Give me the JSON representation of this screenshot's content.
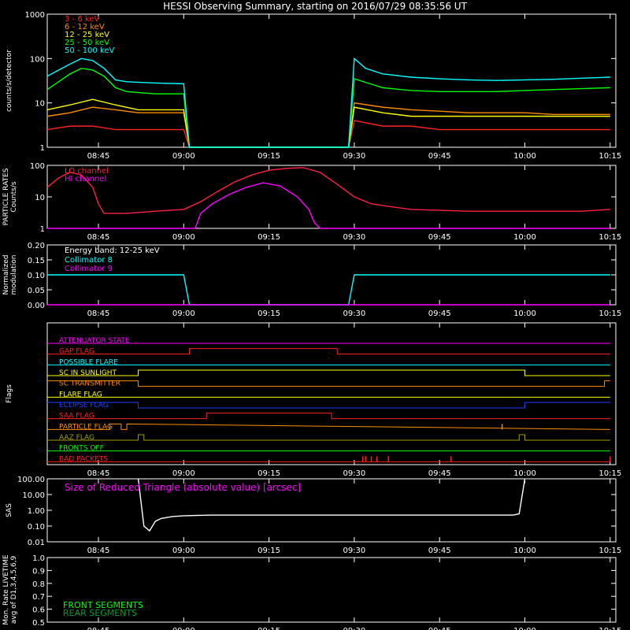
{
  "title": "HESSI Observing Summary, starting on 2016/07/29 08:35:56 UT",
  "time_labels": [
    "08:45",
    "09:00",
    "09:15",
    "09:30",
    "09:45",
    "10:00",
    "10:15"
  ],
  "time_values_min": [
    45,
    60,
    75,
    90,
    105,
    120,
    135
  ],
  "time_range_min": [
    36,
    136
  ],
  "colors": {
    "bg": "#000000",
    "axis": "#ffffff",
    "red": "#ff2020",
    "orange": "#ff8c00",
    "yellow": "#ffff00",
    "green": "#00ff00",
    "cyan": "#00ffff",
    "magenta": "#ff00ff",
    "blue": "#2040ff",
    "olive": "#a0a000",
    "crimson": "#ff2040",
    "darkgreen": "#00a020",
    "salmon": "#ff6060"
  },
  "chart_data": [
    {
      "type": "line",
      "panel": "count-rates",
      "ylabel": "counts/s/detector",
      "ylim": [
        1,
        1000
      ],
      "yscale": "log",
      "yticks": [
        "1",
        "10",
        "100",
        "1000"
      ],
      "ytick_values": [
        1,
        10,
        100,
        1000
      ],
      "data_gaps_min": [
        [
          61,
          89
        ]
      ],
      "series": [
        {
          "name": "3 - 6 keV",
          "color": "#ff2020",
          "x": [
            36,
            40,
            44,
            48,
            52,
            56,
            60,
            61,
            89,
            90,
            95,
            100,
            105,
            110,
            115,
            120,
            125,
            130,
            135
          ],
          "y": [
            2.5,
            3,
            3,
            2.5,
            2.5,
            2.5,
            2.5,
            1,
            1,
            4,
            3,
            3,
            2.5,
            2.5,
            2.5,
            2.5,
            2.5,
            2.5,
            2.5
          ]
        },
        {
          "name": "6 - 12 keV",
          "color": "#ff8c00",
          "x": [
            36,
            40,
            44,
            48,
            52,
            56,
            60,
            61,
            89,
            90,
            95,
            100,
            105,
            110,
            115,
            120,
            125,
            130,
            135
          ],
          "y": [
            5,
            6,
            8,
            7,
            6,
            6,
            6,
            1,
            1,
            10,
            8,
            7,
            6.5,
            6,
            6,
            6,
            5.5,
            5.5,
            5.5
          ]
        },
        {
          "name": "12 - 25 keV",
          "color": "#ffff00",
          "x": [
            36,
            40,
            44,
            48,
            52,
            56,
            60,
            61,
            89,
            90,
            95,
            100,
            105,
            110,
            115,
            120,
            125,
            130,
            135
          ],
          "y": [
            7,
            9,
            12,
            9,
            7,
            7,
            7,
            1,
            1,
            8,
            6,
            5,
            5,
            5,
            5,
            5,
            5,
            5,
            5
          ]
        },
        {
          "name": "25 - 50 keV",
          "color": "#00ff00",
          "x": [
            36,
            38,
            40,
            42,
            44,
            46,
            48,
            50,
            55,
            60,
            61,
            89,
            90,
            95,
            100,
            105,
            110,
            115,
            120,
            125,
            130,
            135
          ],
          "y": [
            20,
            30,
            45,
            60,
            55,
            40,
            22,
            18,
            16,
            16,
            1,
            1,
            35,
            22,
            19,
            18,
            18,
            18,
            19,
            20,
            21,
            22
          ]
        },
        {
          "name": "50 - 100 keV",
          "color": "#00ffff",
          "x": [
            36,
            38,
            40,
            42,
            44,
            46,
            48,
            50,
            55,
            60,
            61,
            89,
            90,
            92,
            95,
            100,
            105,
            110,
            115,
            120,
            125,
            130,
            135
          ],
          "y": [
            40,
            55,
            75,
            100,
            90,
            60,
            33,
            30,
            28,
            27,
            1,
            1,
            100,
            60,
            45,
            38,
            35,
            33,
            32,
            33,
            34,
            36,
            38
          ]
        }
      ]
    },
    {
      "type": "line",
      "panel": "particle-rates",
      "ylabel": "PARTICLE RATES Counts/s",
      "ylim": [
        1,
        100
      ],
      "yscale": "log",
      "yticks": [
        "1",
        "10",
        "100"
      ],
      "ytick_values": [
        1,
        10,
        100
      ],
      "series": [
        {
          "name": "LO channel",
          "color": "#ff2040",
          "x": [
            36,
            38,
            40,
            42,
            44,
            45,
            46,
            47,
            50,
            55,
            60,
            63,
            66,
            69,
            72,
            75,
            78,
            81,
            84,
            87,
            90,
            93,
            96,
            100,
            110,
            120,
            130,
            135
          ],
          "y": [
            20,
            40,
            60,
            50,
            20,
            6,
            3,
            3,
            3,
            3.5,
            4,
            7,
            15,
            30,
            50,
            70,
            80,
            85,
            60,
            25,
            10,
            6,
            5,
            4,
            3.5,
            3.5,
            3.5,
            4
          ]
        },
        {
          "name": "HI channel",
          "color": "#ff00ff",
          "x": [
            36,
            60,
            62,
            63,
            65,
            68,
            71,
            74,
            77,
            80,
            82,
            83,
            84,
            135
          ],
          "y": [
            1,
            1,
            1,
            3,
            6,
            12,
            20,
            28,
            22,
            10,
            4,
            1.5,
            1,
            1
          ]
        }
      ]
    },
    {
      "type": "line",
      "panel": "modulation",
      "ylabel": "Normalized modulation",
      "ylim": [
        0,
        0.2
      ],
      "yticks": [
        "0.00",
        "0.05",
        "0.10",
        "0.15",
        "0.20"
      ],
      "ytick_values": [
        0,
        0.05,
        0.1,
        0.15,
        0.2
      ],
      "annotation": "Energy band: 12-25 keV",
      "series": [
        {
          "name": "Collimator 8",
          "color": "#00ffff",
          "x": [
            36,
            60,
            61,
            89,
            90,
            135
          ],
          "y": [
            0.1,
            0.1,
            0,
            0,
            0.1,
            0.1
          ]
        },
        {
          "name": "Collimator 9",
          "color": "#ff00ff",
          "x": [
            36,
            135
          ],
          "y": [
            0,
            0
          ]
        }
      ]
    },
    {
      "type": "line",
      "panel": "flags",
      "ylabel": "Flags",
      "series": [
        {
          "name": "ATTENUATOR STATE",
          "color": "#ff00ff",
          "x": [
            36,
            135
          ],
          "y": [
            0,
            0
          ]
        },
        {
          "name": "GAP FLAG",
          "color": "#ff2020",
          "x": [
            36,
            61,
            61,
            87,
            87,
            135
          ],
          "y": [
            0,
            0,
            1,
            1,
            0,
            0
          ]
        },
        {
          "name": "POSSIBLE FLARE",
          "color": "#00ffff",
          "x": [
            36,
            135
          ],
          "y": [
            0,
            0
          ]
        },
        {
          "name": "SC IN SUNLIGHT",
          "color": "#ffff00",
          "x": [
            36,
            52,
            52,
            120,
            120,
            135
          ],
          "y": [
            0,
            0,
            1,
            1,
            0,
            0
          ]
        },
        {
          "name": "SC TRANSMITTER",
          "color": "#ff8c00",
          "x": [
            36,
            52,
            52,
            134,
            134,
            135
          ],
          "y": [
            1,
            1,
            0,
            0,
            1,
            1
          ]
        },
        {
          "name": "FLARE FLAG",
          "color": "#ffff00",
          "x": [
            36,
            135
          ],
          "y": [
            0,
            0
          ]
        },
        {
          "name": "ECLIPSE FLAG",
          "color": "#2040ff",
          "x": [
            36,
            52,
            52,
            120,
            120,
            135
          ],
          "y": [
            1,
            1,
            0,
            0,
            1,
            1
          ]
        },
        {
          "name": "SAA FLAG",
          "color": "#ff2020",
          "x": [
            36,
            64,
            64,
            86,
            86,
            135
          ],
          "y": [
            0,
            0,
            1,
            1,
            0,
            0
          ]
        },
        {
          "name": "PARTICLE FLAG",
          "color": "#ff8c00",
          "x": [
            36,
            47,
            47,
            49,
            49,
            50,
            50,
            135
          ],
          "y": [
            0,
            0,
            1,
            1,
            0,
            0,
            1,
            0
          ]
        },
        {
          "name": "AAZ FLAG",
          "color": "#a0a000",
          "x": [
            36,
            52,
            52,
            53,
            53,
            119,
            119,
            120,
            120,
            135
          ],
          "y": [
            0,
            0,
            1,
            1,
            0,
            0,
            1,
            1,
            0,
            0
          ]
        },
        {
          "name": "FRONTS OFF",
          "color": "#00ff00",
          "x": [
            36,
            135
          ],
          "y": [
            0,
            0
          ]
        },
        {
          "name": "BAD PACKETS",
          "color": "#ff2020",
          "x": [
            36,
            135
          ],
          "y": [
            0,
            0
          ]
        }
      ],
      "spikes": [
        {
          "name": "PARTICLE FLAG",
          "x": [
            116
          ]
        },
        {
          "name": "BAD PACKETS",
          "x": [
            91.5,
            92,
            93,
            94,
            96,
            107,
            135
          ]
        }
      ]
    },
    {
      "type": "line",
      "panel": "sas",
      "ylabel": "SAS",
      "title": "Size of Reduced Triangle (absolute value) [arcsec]",
      "ylim": [
        0.01,
        100
      ],
      "yscale": "log",
      "yticks": [
        "0.01",
        "0.10",
        "1.00",
        "10.00",
        "100.00"
      ],
      "ytick_values": [
        0.01,
        0.1,
        1,
        10,
        100
      ],
      "series": [
        {
          "name": "Size of Reduced Triangle",
          "color": "#ffffff",
          "x": [
            52,
            53,
            54,
            55,
            56,
            58,
            60,
            65,
            70,
            80,
            90,
            100,
            110,
            118,
            119,
            120
          ],
          "y": [
            100,
            0.1,
            0.05,
            0.2,
            0.3,
            0.4,
            0.45,
            0.5,
            0.5,
            0.5,
            0.5,
            0.5,
            0.5,
            0.5,
            0.6,
            100
          ]
        }
      ]
    },
    {
      "type": "line",
      "panel": "livetime",
      "ylabel": "Mon. Rate LIVETIME avg of D1,3,4,5,6,9",
      "ylim": [
        0.5,
        1.0
      ],
      "yticks": [
        "0.5",
        "0.6",
        "0.7",
        "0.8",
        "0.9",
        "1.0"
      ],
      "ytick_values": [
        0.5,
        0.6,
        0.7,
        0.8,
        0.9,
        1.0
      ],
      "series": [
        {
          "name": "FRONT SEGMENTS",
          "color": "#00ff00",
          "x": [],
          "y": []
        },
        {
          "name": "REAR SEGMENTS",
          "color": "#00a020",
          "x": [],
          "y": []
        }
      ]
    }
  ]
}
